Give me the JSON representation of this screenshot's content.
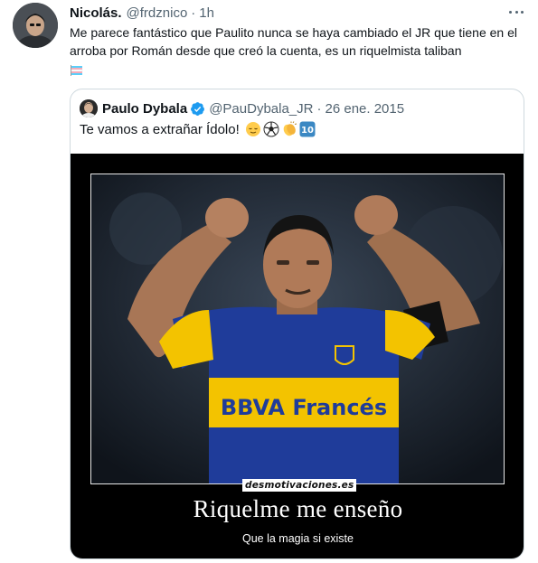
{
  "tweet": {
    "author_name": "Nicolás.",
    "handle": "@frdznico",
    "separator": "·",
    "time": "1h",
    "text": "Me parece fantástico que Paulito nunca se haya cambiado el JR que tiene en el arroba por Román desde que creó la cuenta, es un riquelmista taliban",
    "trailing_emoji": "transgender-flag-emoji"
  },
  "quote": {
    "author_name": "Paulo Dybala",
    "verified": true,
    "handle": "@PauDybala_JR",
    "separator": "·",
    "date": "26 ene. 2015",
    "text": "Te vamos a extrañar Ídolo!",
    "emojis": [
      "relieved-face-emoji",
      "soccer-ball-emoji",
      "clapping-hands-emoji",
      "keycap-ten-emoji"
    ],
    "media": {
      "watermark": "desmotivaciones.es",
      "title": "Riquelme me enseño",
      "subtitle": "Que la magia si existe",
      "jersey_sponsor": "BBVA Francés"
    }
  },
  "colors": {
    "text_primary": "#0f1419",
    "text_secondary": "#536471",
    "border": "#cfd9de",
    "verified_blue": "#1d9bf0",
    "jersey_blue": "#1f3c9a",
    "jersey_yellow": "#f3c300"
  }
}
